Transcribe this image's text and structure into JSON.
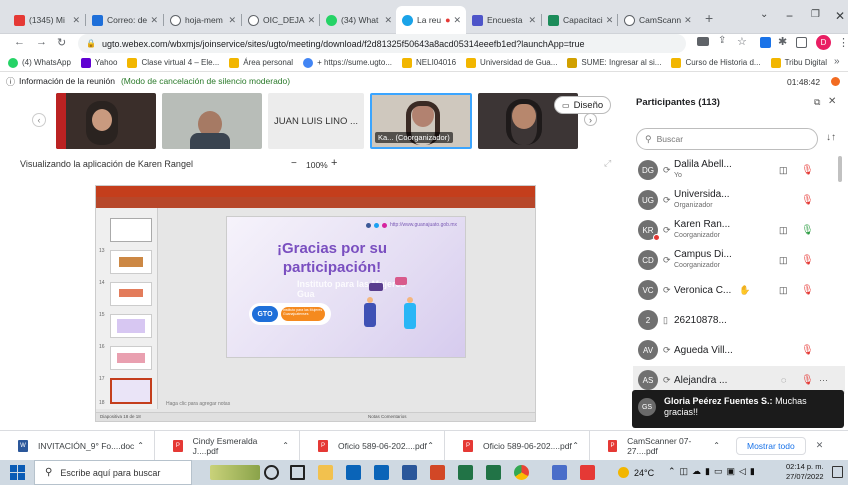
{
  "browser": {
    "tabs": [
      {
        "label": "(1345) Mi",
        "color": "#e53935"
      },
      {
        "label": "Correo: de",
        "color": "#1e6fd9"
      },
      {
        "label": "hoja-mem",
        "color": "#5f6368"
      },
      {
        "label": "OIC_DEJA",
        "color": "#5f6368"
      },
      {
        "label": "(34) What",
        "color": "#25d366"
      },
      {
        "label": "La reu",
        "color": "#1aa3e8"
      },
      {
        "label": "Encuesta",
        "color": "#4e55c9"
      },
      {
        "label": "Capacitaci",
        "color": "#1c8c5a"
      },
      {
        "label": "CamScann",
        "color": "#5f6368"
      }
    ],
    "new_tab": "+",
    "url": "ugto.webex.com/wbxmjs/joinservice/sites/ugto/meeting/download/f2d81325f50643a8acd05314eeefb1ed?launchApp=true",
    "bookmarks": [
      {
        "label": "(4) WhatsApp",
        "color": "#25d366"
      },
      {
        "label": "Yahoo",
        "color": "#6001d2"
      },
      {
        "label": "Clase virtual 4 – Ele...",
        "color": "#f2b600"
      },
      {
        "label": "Área personal",
        "color": "#f2b600"
      },
      {
        "label": "+ https://sume.ugto...",
        "color": "#4285f4"
      },
      {
        "label": "NELI04016",
        "color": "#f2b600"
      },
      {
        "label": "Universidad de Gua...",
        "color": "#f2b600"
      },
      {
        "label": "SUME: Ingresar al si...",
        "color": "#d1a000"
      },
      {
        "label": "Curso de Historia d...",
        "color": "#f2b600"
      },
      {
        "label": "Tribu Digital",
        "color": "#f2b600"
      }
    ]
  },
  "meeting": {
    "info_title": "Información de la reunión",
    "info_mode": "(Modo de cancelación de silencio moderado)",
    "timer": "01:48:42",
    "video_tiles": [
      {
        "label": ""
      },
      {
        "label": ""
      },
      {
        "label": "JUAN LUIS LINO ..."
      },
      {
        "label": "Ka... (Coorganizador)"
      },
      {
        "label": ""
      }
    ],
    "layout_button": "Diseño",
    "sharing_label": "Visualizando la aplicación de Karen Rangel",
    "zoom": "100%",
    "zoom_minus": "−",
    "zoom_plus": "+"
  },
  "slide": {
    "title": "¡Gracias por su participación!",
    "url": "http://www.guanajuato.gob.mx",
    "logo": "GTO",
    "badge": "Instituto para las Mujeres Guanajuatenses",
    "watermark": "Instituto para las Mujeres Gua"
  },
  "ppt": {
    "caption": "Haga clic para agregar notas",
    "status_left": "Diapositiva 18 de 18",
    "status_right": "Notas  Comentarios",
    "slide_numbers": [
      "13",
      "14",
      "15",
      "16",
      "17",
      "18"
    ]
  },
  "participants": {
    "title": "Participantes (113)",
    "search_placeholder": "Buscar",
    "list": [
      {
        "initials": "DG",
        "name": "Dalila Abell...",
        "role": "Yo",
        "color": "#707070"
      },
      {
        "initials": "UG",
        "name": "Universida...",
        "role": "Organizador",
        "color": "#707070"
      },
      {
        "initials": "KR",
        "name": "Karen Ran...",
        "role": "Coorganizador",
        "color": "#707070"
      },
      {
        "initials": "CD",
        "name": "Campus Di...",
        "role": "Coorganizador",
        "color": "#707070"
      },
      {
        "initials": "VC",
        "name": "Veronica C...",
        "role": "",
        "color": "#707070"
      },
      {
        "initials": "2",
        "name": "26210878...",
        "role": "",
        "color": "#707070"
      },
      {
        "initials": "AV",
        "name": "Agueda Vill...",
        "role": "",
        "color": "#707070"
      },
      {
        "initials": "AS",
        "name": "Alejandra ...",
        "role": "",
        "color": "#707070"
      }
    ],
    "chat_initials": "GS",
    "chat_sender": "Gloria Peérez Fuentes S.:",
    "chat_message": "Muchas gracias!!"
  },
  "downloads": {
    "items": [
      {
        "label": "INVITACIÓN_9° Fo....doc"
      },
      {
        "label": "Cindy Esmeralda J....pdf"
      },
      {
        "label": "Oficio 589-06-202....pdf"
      },
      {
        "label": "Oficio 589-06-202....pdf"
      },
      {
        "label": "CamScanner 07-27....pdf"
      }
    ],
    "show_all": "Mostrar todo"
  },
  "taskbar": {
    "search_placeholder": "Escribe aquí para buscar",
    "temperature": "24°C",
    "time": "02:14 p. m.",
    "date": "27/07/2022"
  }
}
